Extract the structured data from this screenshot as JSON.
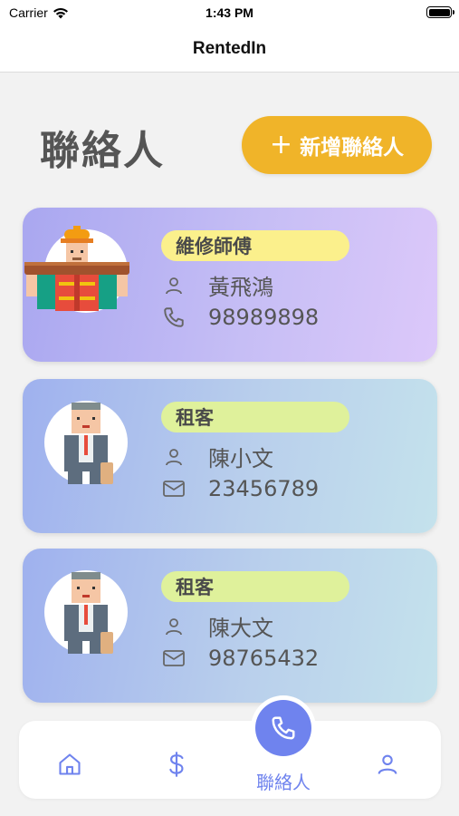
{
  "status_bar": {
    "carrier": "Carrier",
    "time": "1:43 PM"
  },
  "nav": {
    "title": "RentedIn"
  },
  "page": {
    "title": "聯絡人",
    "add_button_label": "新增聯絡人"
  },
  "contacts": [
    {
      "role": "維修師傅",
      "name": "黃飛鴻",
      "contact": "98989898",
      "contact_type": "phone",
      "avatar": "worker-avatar"
    },
    {
      "role": "租客",
      "name": "陳小文",
      "contact": "23456789",
      "contact_type": "email",
      "avatar": "businessman-avatar"
    },
    {
      "role": "租客",
      "name": "陳大文",
      "contact": "98765432",
      "contact_type": "email",
      "avatar": "businessman-avatar"
    }
  ],
  "tab_bar": {
    "items": [
      {
        "icon": "home-icon"
      },
      {
        "icon": "dollar-icon"
      },
      {
        "icon": "phone-icon",
        "label": "聯絡人",
        "active": true
      },
      {
        "icon": "person-icon"
      }
    ]
  },
  "colors": {
    "accent": "#6f83ee",
    "add_button": "#f0b429",
    "role_tag_worker": "#fbf08c",
    "role_tag_tenant": "#dff19b"
  }
}
